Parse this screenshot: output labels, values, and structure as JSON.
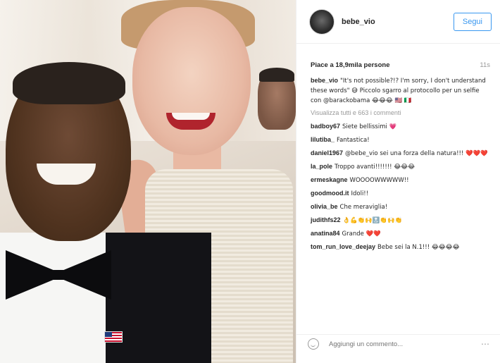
{
  "header": {
    "username": "bebe_vio",
    "follow_label": "Segui"
  },
  "likes": {
    "text": "Piace a 18,9mila persone",
    "age": "11s"
  },
  "caption": {
    "author": "bebe_vio",
    "text": "\"It's not possible?!? I'm sorry, I don't understand these words\" 😅 Piccolo sgarro al protocollo per un selfie con @barackobama 😂😂😂 🇺🇸 🇮🇹"
  },
  "view_all": "Visualizza tutti e 663 i commenti",
  "comments": [
    {
      "author": "badboy67",
      "text": "Siete bellissimi 💗"
    },
    {
      "author": "lilutiba_",
      "text": "Fantastica!"
    },
    {
      "author": "daniel1967",
      "text": "@bebe_vio sei una forza della natura!!! ❤️❤️❤️"
    },
    {
      "author": "la_pole",
      "text": "Troppo avanti!!!!!!! 😂😂😂"
    },
    {
      "author": "ermeskagne",
      "text": "WOOOOWWWWW!!"
    },
    {
      "author": "goodmood.it",
      "text": "Idoli!!"
    },
    {
      "author": "olivia_be",
      "text": "Che meraviglia!"
    },
    {
      "author": "judithfs22",
      "text": "👌💪👏🙌🔝👏🙌👏"
    },
    {
      "author": "anatina84",
      "text": "Grande ❤️❤️"
    },
    {
      "author": "tom_run_love_deejay",
      "text": "Bebe sei la N.1!!! 😂😂😂😂"
    }
  ],
  "add_comment_placeholder": "Aggiungi un commento...",
  "more_icon": "⋯"
}
